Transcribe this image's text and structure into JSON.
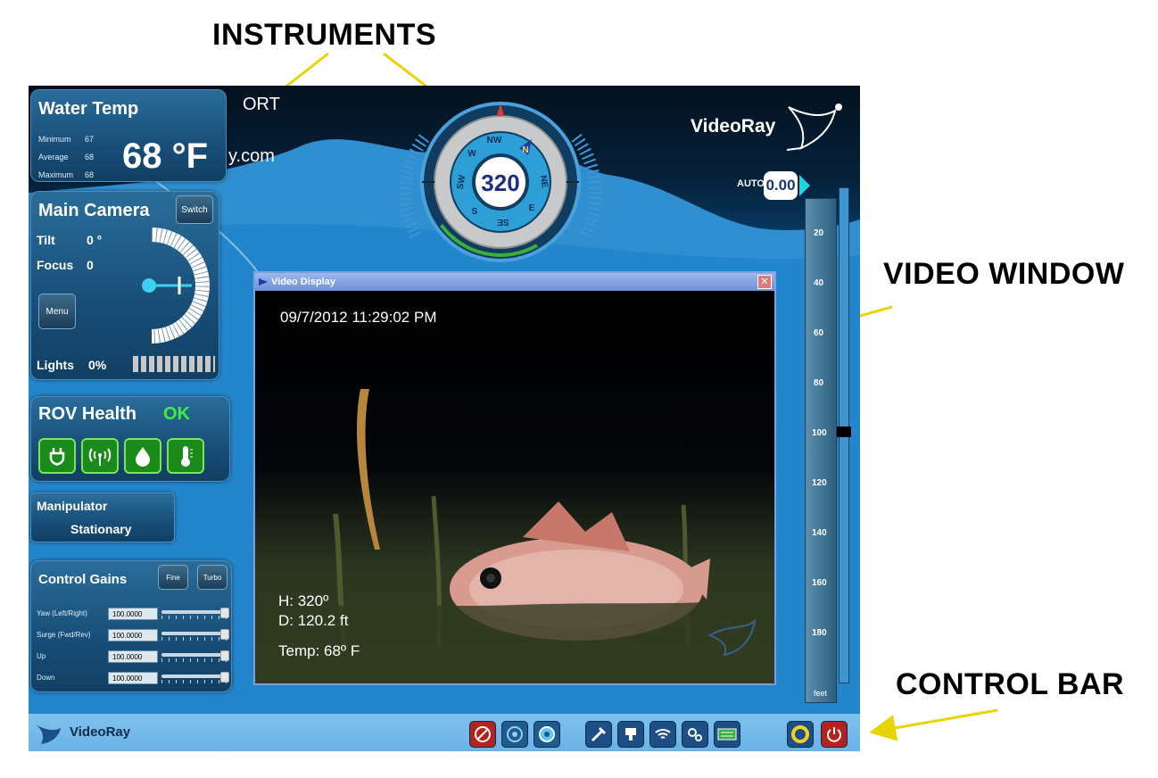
{
  "callouts": {
    "instruments": "INSTRUMENTS",
    "video_window": "VIDEO WINDOW",
    "control_bar": "CONTROL BAR"
  },
  "background": {
    "text_port": "ORT",
    "text_com": "y.com"
  },
  "water_temp": {
    "title": "Water Temp",
    "minimum_label": "Minimum",
    "minimum_value": "67",
    "average_label": "Average",
    "average_value": "68",
    "maximum_label": "Maximum",
    "maximum_value": "68",
    "current": "68 °F"
  },
  "main_camera": {
    "title": "Main Camera",
    "switch_label": "Switch",
    "tilt_label": "Tilt",
    "tilt_value": "0 °",
    "focus_label": "Focus",
    "focus_value": "0",
    "menu_label": "Menu",
    "lights_label": "Lights",
    "lights_value": "0%"
  },
  "rov_health": {
    "title": "ROV Health",
    "status": "OK",
    "icons": [
      "power-icon",
      "signal-icon",
      "water-drop-icon",
      "thermometer-icon"
    ]
  },
  "manipulator": {
    "title": "Manipulator",
    "state": "Stationary"
  },
  "control_gains": {
    "title": "Control Gains",
    "fine_label": "Fine",
    "turbo_label": "Turbo",
    "rows": [
      {
        "label": "Yaw   (Left/Right)",
        "value": "100.0000",
        "level": 1.0
      },
      {
        "label": "Surge (Fwd/Rev)",
        "value": "100.0000",
        "level": 1.0
      },
      {
        "label": "Up",
        "value": "100.0000",
        "level": 1.0
      },
      {
        "label": "Down",
        "value": "100.0000",
        "level": 1.0
      }
    ]
  },
  "compass": {
    "heading": "320",
    "cardinals": [
      "NW",
      "N",
      "NE",
      "E",
      "SE",
      "S",
      "SW",
      "W"
    ]
  },
  "brand": {
    "logo_text": "VideoRay"
  },
  "depth": {
    "auto_label": "AUTO",
    "auto_value": "0.00",
    "ticks": [
      "20",
      "40",
      "60",
      "80",
      "100",
      "120",
      "140",
      "160",
      "180"
    ],
    "unit": "feet"
  },
  "video_window": {
    "title": "Video Display",
    "close_label": "✕",
    "timestamp": "09/7/2012 11:29:02 PM",
    "heading": "H: 320º",
    "depth": "D: 120.2 ft",
    "temp": "Temp: 68º F"
  },
  "control_bar": {
    "brand": "VideoRay",
    "buttons": [
      "stop-icon",
      "camera-icon",
      "camera-alt-icon",
      "tools-icon",
      "manipulator-icon",
      "wifi-icon",
      "settings-icon",
      "keyboard-icon",
      "record-icon",
      "power-icon"
    ]
  },
  "colors": {
    "accent": "#3a8fd0",
    "ok_green": "#3ff03a",
    "panel_dark": "#184e78",
    "callout_arrow": "#e8d400"
  }
}
